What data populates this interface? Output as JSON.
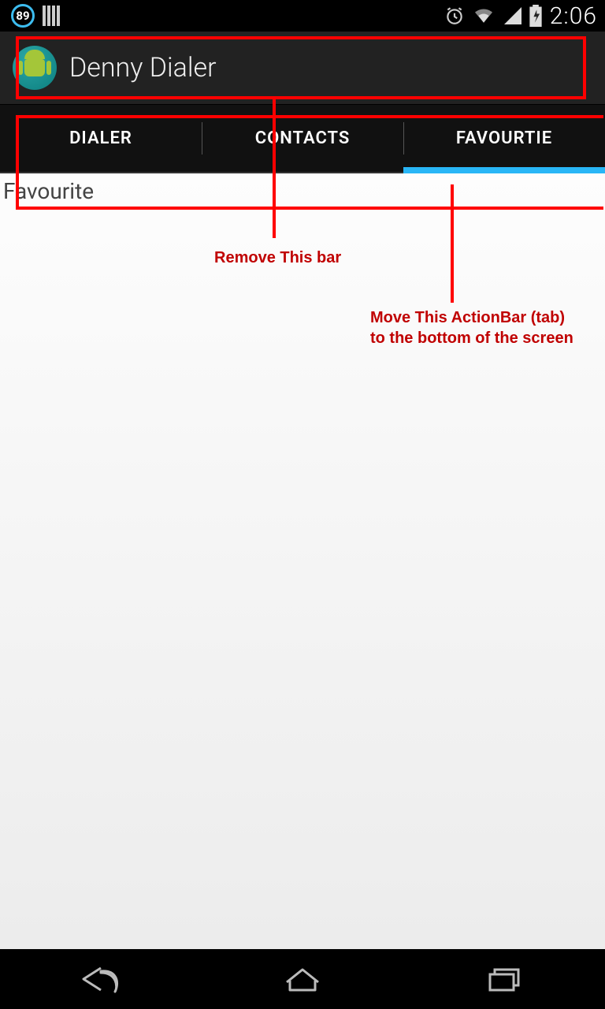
{
  "status": {
    "battery_pct": "89",
    "time": "2:06"
  },
  "actionbar": {
    "title": "Denny Dialer"
  },
  "tabs": [
    {
      "label": "DIALER"
    },
    {
      "label": "CONTACTS"
    },
    {
      "label": "FAVOURTIE"
    }
  ],
  "content": {
    "heading": "Favourite"
  },
  "annotations": {
    "remove_bar": "Remove This bar",
    "move_tab_l1": "Move This ActionBar (tab)",
    "move_tab_l2": "to the bottom of the screen"
  }
}
